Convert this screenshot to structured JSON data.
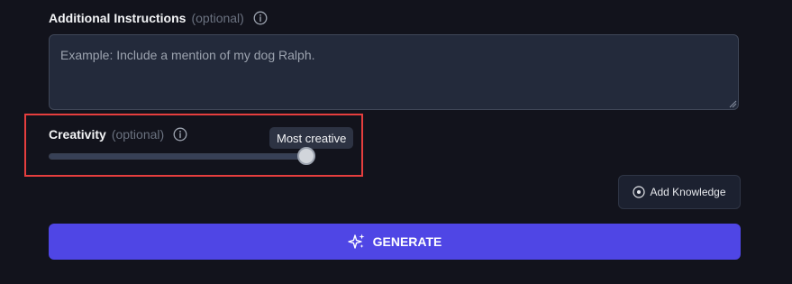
{
  "instructions": {
    "label": "Additional Instructions",
    "optional": "(optional)",
    "placeholder": "Example: Include a mention of my dog Ralph.",
    "value": ""
  },
  "creativity": {
    "label": "Creativity",
    "optional": "(optional)",
    "tooltip": "Most creative",
    "level_fraction": 1.0
  },
  "add_knowledge": {
    "label": "Add Knowledge",
    "icon": "plus-circle-icon"
  },
  "generate": {
    "label": "GENERATE",
    "icon": "sparkles-icon"
  },
  "colors": {
    "background": "#12131c",
    "accent": "#4f46e5",
    "highlight": "#e53e3e"
  }
}
